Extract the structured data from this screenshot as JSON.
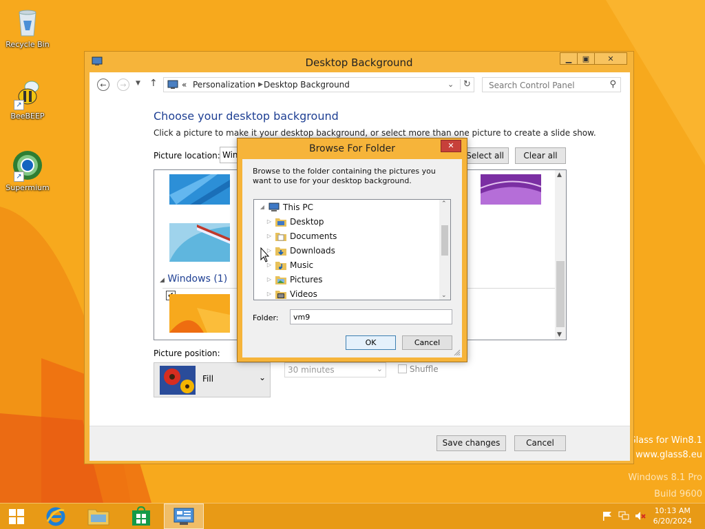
{
  "desktop": {
    "icons": [
      {
        "label": "Recycle Bin"
      },
      {
        "label": "BeeBEEP"
      },
      {
        "label": "Supermium"
      }
    ],
    "watermark_lines": [
      "Glass for Win8.1",
      "www.glass8.eu",
      "Windows 8.1 Pro",
      "Build 9600"
    ]
  },
  "window": {
    "title": "Desktop Background",
    "breadcrumb_prefix": "«",
    "breadcrumb": [
      "Personalization",
      "Desktop Background"
    ],
    "search_placeholder": "Search Control Panel",
    "heading": "Choose your desktop background",
    "description": "Click a picture to make it your desktop background, or select more than one picture to create a slide show.",
    "picture_location_label": "Picture location:",
    "picture_location_value": "Windows Desktop Backgrounds",
    "select_all": "Select all",
    "clear_all": "Clear all",
    "group_label": "Windows (1)",
    "picture_position_label": "Picture position:",
    "picture_position_value": "Fill",
    "interval_value": "30 minutes",
    "shuffle_label": "Shuffle",
    "save_changes": "Save changes",
    "cancel": "Cancel"
  },
  "dialog": {
    "title": "Browse For Folder",
    "instructions": "Browse to the folder containing the pictures you want to use for your desktop background.",
    "tree": [
      {
        "label": "This PC",
        "level": 0,
        "expanded": true
      },
      {
        "label": "Desktop",
        "level": 1
      },
      {
        "label": "Documents",
        "level": 1
      },
      {
        "label": "Downloads",
        "level": 1
      },
      {
        "label": "Music",
        "level": 1
      },
      {
        "label": "Pictures",
        "level": 1
      },
      {
        "label": "Videos",
        "level": 1
      }
    ],
    "folder_label": "Folder:",
    "folder_value": "vm9",
    "ok": "OK",
    "cancel": "Cancel"
  },
  "taskbar": {
    "apps": [
      "start-button",
      "internet-explorer",
      "file-explorer",
      "store",
      "control-panel"
    ],
    "time": "10:13 AM",
    "date": "6/20/2024"
  },
  "colors": {
    "wallpaper": "#f7a91d",
    "accent": "#1e3f93",
    "window_frame": "#f6b43a",
    "close_red": "#c7403a"
  }
}
